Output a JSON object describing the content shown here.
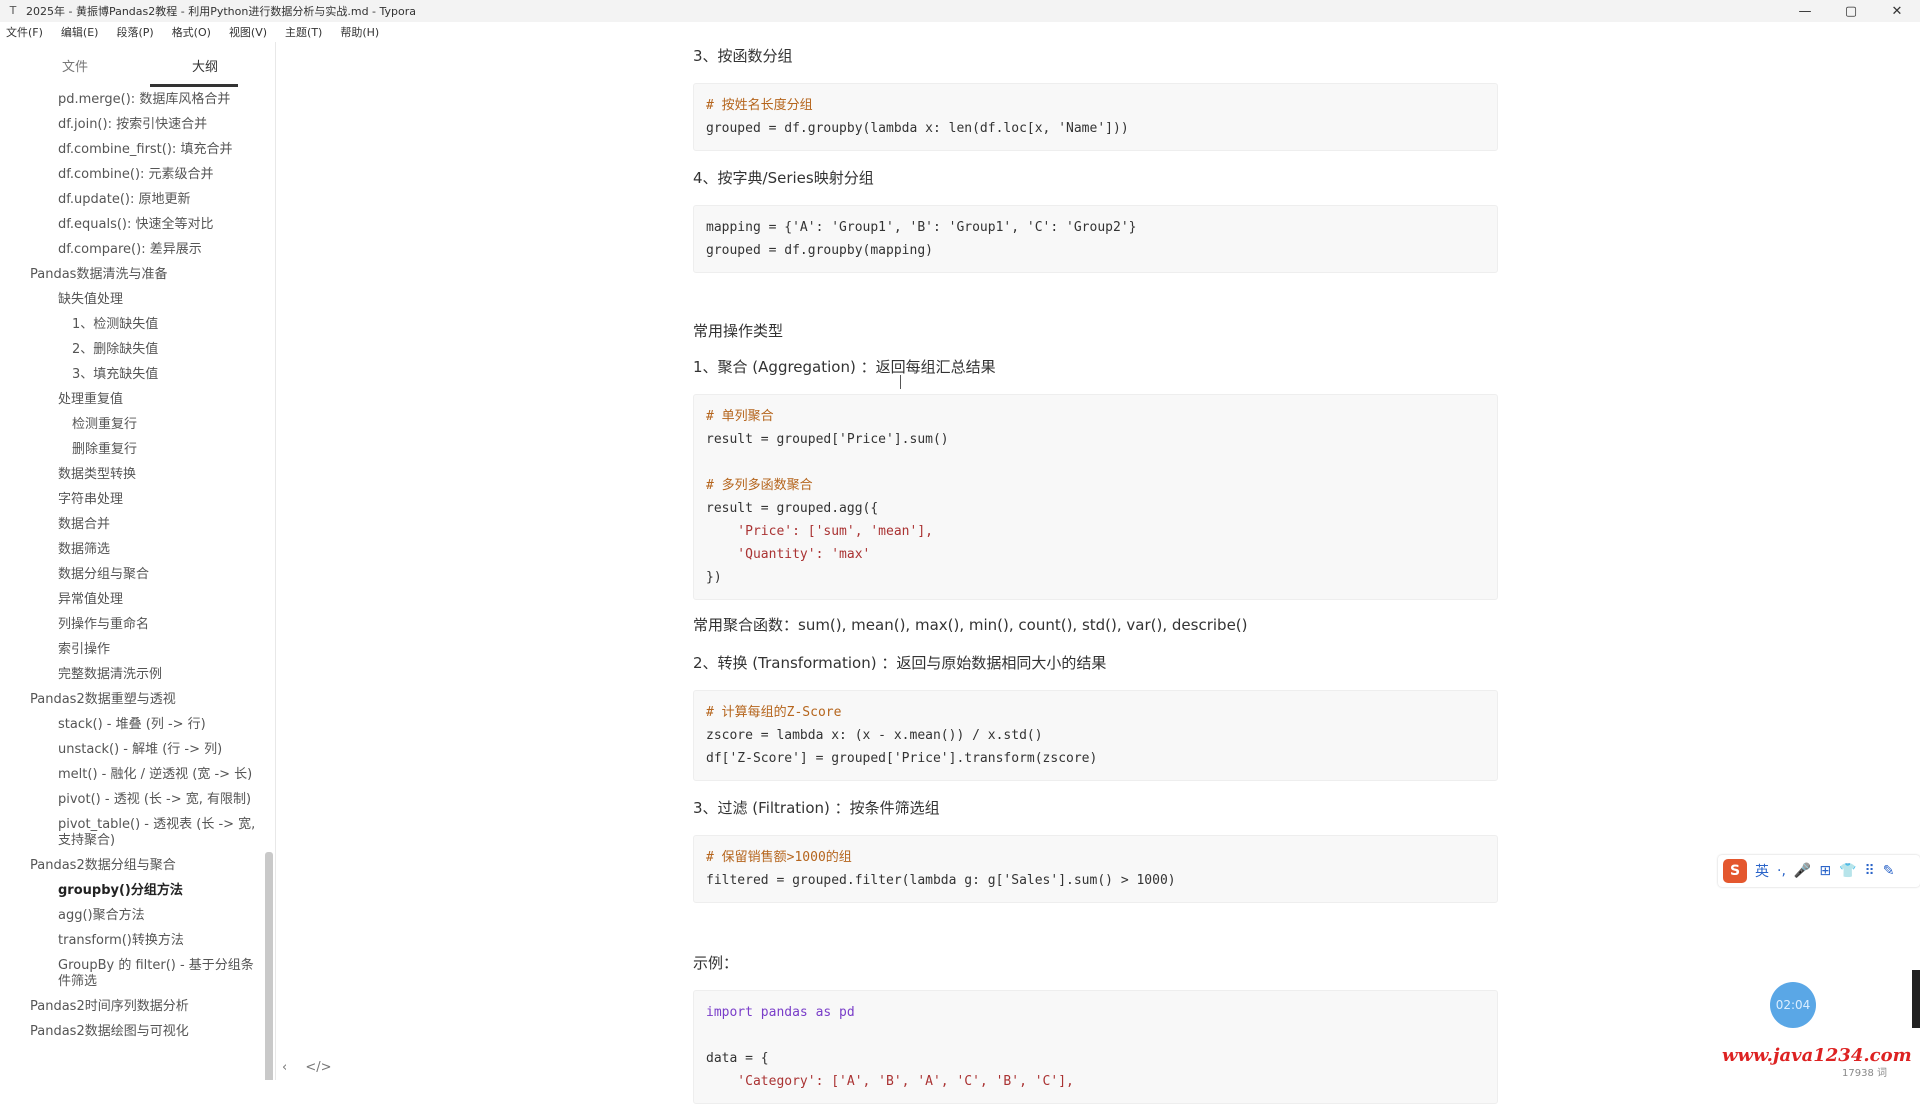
{
  "window": {
    "title": "2025年 - 黄振博Pandas2教程 - 利用Python进行数据分析与实战.md - Typora",
    "controls": {
      "minimize": "—",
      "maximize": "▢",
      "close": "✕"
    }
  },
  "menu": [
    "文件(F)",
    "编辑(E)",
    "段落(P)",
    "格式(O)",
    "视图(V)",
    "主题(T)",
    "帮助(H)"
  ],
  "sidebar": {
    "tabs": [
      "文件",
      "大纲"
    ],
    "items": [
      {
        "text": "pd.merge(): 数据库风格合并",
        "level": 2
      },
      {
        "text": "df.join(): 按索引快速合并",
        "level": 2
      },
      {
        "text": "df.combine_first(): 填充合并",
        "level": 2
      },
      {
        "text": "df.combine(): 元素级合并",
        "level": 2
      },
      {
        "text": "df.update(): 原地更新",
        "level": 2
      },
      {
        "text": "df.equals(): 快速全等对比",
        "level": 2
      },
      {
        "text": "df.compare(): 差异展示",
        "level": 2
      },
      {
        "text": "Pandas数据清洗与准备",
        "level": 1
      },
      {
        "text": "缺失值处理",
        "level": 2
      },
      {
        "text": "1、检测缺失值",
        "level": 3
      },
      {
        "text": "2、删除缺失值",
        "level": 3
      },
      {
        "text": "3、填充缺失值",
        "level": 3
      },
      {
        "text": "处理重复值",
        "level": 2
      },
      {
        "text": "检测重复行",
        "level": 3
      },
      {
        "text": "删除重复行",
        "level": 3
      },
      {
        "text": "数据类型转换",
        "level": 2
      },
      {
        "text": "字符串处理",
        "level": 2
      },
      {
        "text": "数据合并",
        "level": 2
      },
      {
        "text": "数据筛选",
        "level": 2
      },
      {
        "text": "数据分组与聚合",
        "level": 2
      },
      {
        "text": "异常值处理",
        "level": 2
      },
      {
        "text": "列操作与重命名",
        "level": 2
      },
      {
        "text": "索引操作",
        "level": 2
      },
      {
        "text": "完整数据清洗示例",
        "level": 2
      },
      {
        "text": "Pandas2数据重塑与透视",
        "level": 1
      },
      {
        "text": "stack() - 堆叠 (列 -> 行)",
        "level": 2
      },
      {
        "text": "unstack() - 解堆 (行 -> 列)",
        "level": 2
      },
      {
        "text": "melt() - 融化 / 逆透视 (宽 -> 长)",
        "level": 2
      },
      {
        "text": "pivot() - 透视 (长 -> 宽, 有限制)",
        "level": 2
      },
      {
        "text": "pivot_table() - 透视表 (长 -> 宽, 支持聚合)",
        "level": 2
      },
      {
        "text": "Pandas2数据分组与聚合",
        "level": 1
      },
      {
        "text": "groupby()分组方法",
        "level": 2,
        "active": true
      },
      {
        "text": "agg()聚合方法",
        "level": 2
      },
      {
        "text": "transform()转换方法",
        "level": 2
      },
      {
        "text": "GroupBy 的 filter() - 基于分组条件筛选",
        "level": 2
      },
      {
        "text": "Pandas2时间序列数据分析",
        "level": 1
      },
      {
        "text": "Pandas2数据绘图与可视化",
        "level": 1
      }
    ],
    "footer": [
      "‹",
      "</>"
    ]
  },
  "doc": {
    "h3_multi": "3、按函数分组",
    "code1_comment": "# 按姓名长度分组",
    "code1_line": "grouped = df.groupby(lambda x: len(df.loc[x, 'Name']))",
    "h4_dict": "4、按字典/Series映射分组",
    "code2_line1": "mapping = {'A': 'Group1', 'B': 'Group1', 'C': 'Group2'}",
    "code2_line2": "grouped = df.groupby(mapping)",
    "ops_title": "常用操作类型",
    "agg_title": "1、聚合 (Aggregation) ：返回每组汇总结果",
    "code3_c1": "# 单列聚合",
    "code3_l1": "result = grouped['Price'].sum()",
    "code3_c2": "# 多列多函数聚合",
    "code3_l2": "result = grouped.agg({",
    "code3_l3": "    'Price': ['sum', 'mean'],",
    "code3_l4": "    'Quantity': 'max'",
    "code3_l5": "})",
    "agg_funcs": "常用聚合函数：sum(), mean(), max(), min(), count(), std(), var(), describe()",
    "trans_title": "2、转换 (Transformation) ：返回与原始数据相同大小的结果",
    "code4_c1": "# 计算每组的Z-Score",
    "code4_l1": "zscore = lambda x: (x - x.mean()) / x.std()",
    "code4_l2": "df['Z-Score'] = grouped['Price'].transform(zscore)",
    "filter_title": "3、过滤 (Filtration) ：按条件筛选组",
    "code5_c1": "# 保留销售额>1000的组",
    "code5_l1": "filtered = grouped.filter(lambda g: g['Sales'].sum() > 1000)",
    "example_title": "示例：",
    "code6_l1": "import pandas as pd",
    "code6_l2": "data = {",
    "code6_l3": "    'Category': ['A', 'B', 'A', 'C', 'B', 'C'],"
  },
  "overlay": {
    "ime_logo": "S",
    "ime_items": [
      "英",
      "·,",
      "🎤",
      "⊞",
      "👕",
      "⠿",
      "✎"
    ],
    "timer": "02:04",
    "watermark": "www.java1234.com",
    "wordcount": "17938 词"
  }
}
